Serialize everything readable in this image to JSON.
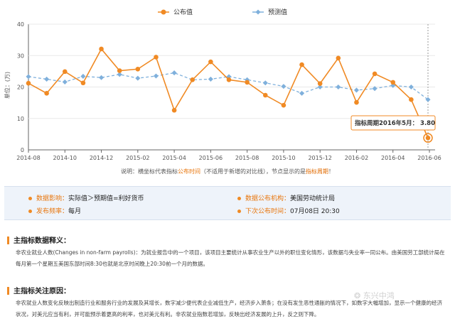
{
  "chart_data": {
    "type": "line",
    "x": [
      "2014-08",
      "2014-09",
      "2014-10",
      "2014-11",
      "2014-12",
      "2015-01",
      "2015-02",
      "2015-03",
      "2015-04",
      "2015-05",
      "2015-06",
      "2015-07",
      "2015-08",
      "2015-09",
      "2015-10",
      "2015-11",
      "2015-12",
      "2016-01",
      "2016-02",
      "2016-03",
      "2016-04",
      "2016-05"
    ],
    "x_ticks": [
      "2014-08",
      "2014-10",
      "2014-12",
      "2015-02",
      "2015-04",
      "2015-06",
      "2015-08",
      "2015-10",
      "2015-12",
      "2016-02",
      "2016-04",
      "2016-06"
    ],
    "series": [
      {
        "name": "公布值",
        "color": "#f08a24",
        "values": [
          21.2,
          18.0,
          24.9,
          21.3,
          32.1,
          25.2,
          25.7,
          29.5,
          12.6,
          22.3,
          28.0,
          22.3,
          21.5,
          17.4,
          14.2,
          27.1,
          21.1,
          29.2,
          15.1,
          24.2,
          21.5,
          16.0
        ]
      },
      {
        "name": "预测值",
        "color": "#7fb0dc",
        "values": [
          23.3,
          22.5,
          21.6,
          23.4,
          23.0,
          24.0,
          22.8,
          23.5,
          24.5,
          22.3,
          22.5,
          23.3,
          22.3,
          21.3,
          20.2,
          18.0,
          20.0,
          20.0,
          19.0,
          19.5,
          20.5,
          20.0
        ]
      }
    ],
    "ylim": [
      0,
      40
    ],
    "yticks": [
      0,
      10,
      20,
      30,
      40
    ],
    "ylabel": "单位：(万)",
    "grid": true,
    "legend": "top-center",
    "tooltip": {
      "label": "指标周期2016年5月：",
      "value": "3.80",
      "y": 3.8
    },
    "extra_forecast_point": {
      "x": "2016-06",
      "y": 16.0
    }
  },
  "note": {
    "prefix": "说明：横坐标代表指标",
    "hl": "公布时间",
    "mid": "（不适用于新增的对比线），节点显示的是",
    "pr": "指标周期",
    "end": "！"
  },
  "info": {
    "impact_key": "数据影响：",
    "impact_val": "实际值＞预期值=利好货币",
    "agency_key": "数据公布机构：",
    "agency_val": "美国劳动统计局",
    "freq_key": "发布频率：",
    "freq_val": "每月",
    "next_key": "下次公布时间：",
    "next_val": "07月08日 20:30"
  },
  "section1": {
    "title": "主指标数据释义：",
    "text": "非农业就业人数(Changes in non-farm payrolls)：为就业报告中的一个项目，该项目主要统计从事农业生产以外的职位变化情形，该数据与失业率一同公布。由美国劳工部统计局在每月第一个星期五美国东部时间8:30也就是北京时间晚上20:30前一个月的数据。"
  },
  "section2": {
    "title": "主指标关注原因：",
    "text": "非农就业人数变化反映出制造行业和服务行业的发展及其增长，数字减少便代表企业减低生产，经济步入萧条；在没有发生恶性通胀的情况下，如数字大幅增加，显示一个健康的经济状况，对美元应当有利，并可能预示着更高的利率，也对美元有利。非农就业指数若增加，反映出经济发展的上升，反之则下降。"
  },
  "watermark": "东兴中鸿"
}
